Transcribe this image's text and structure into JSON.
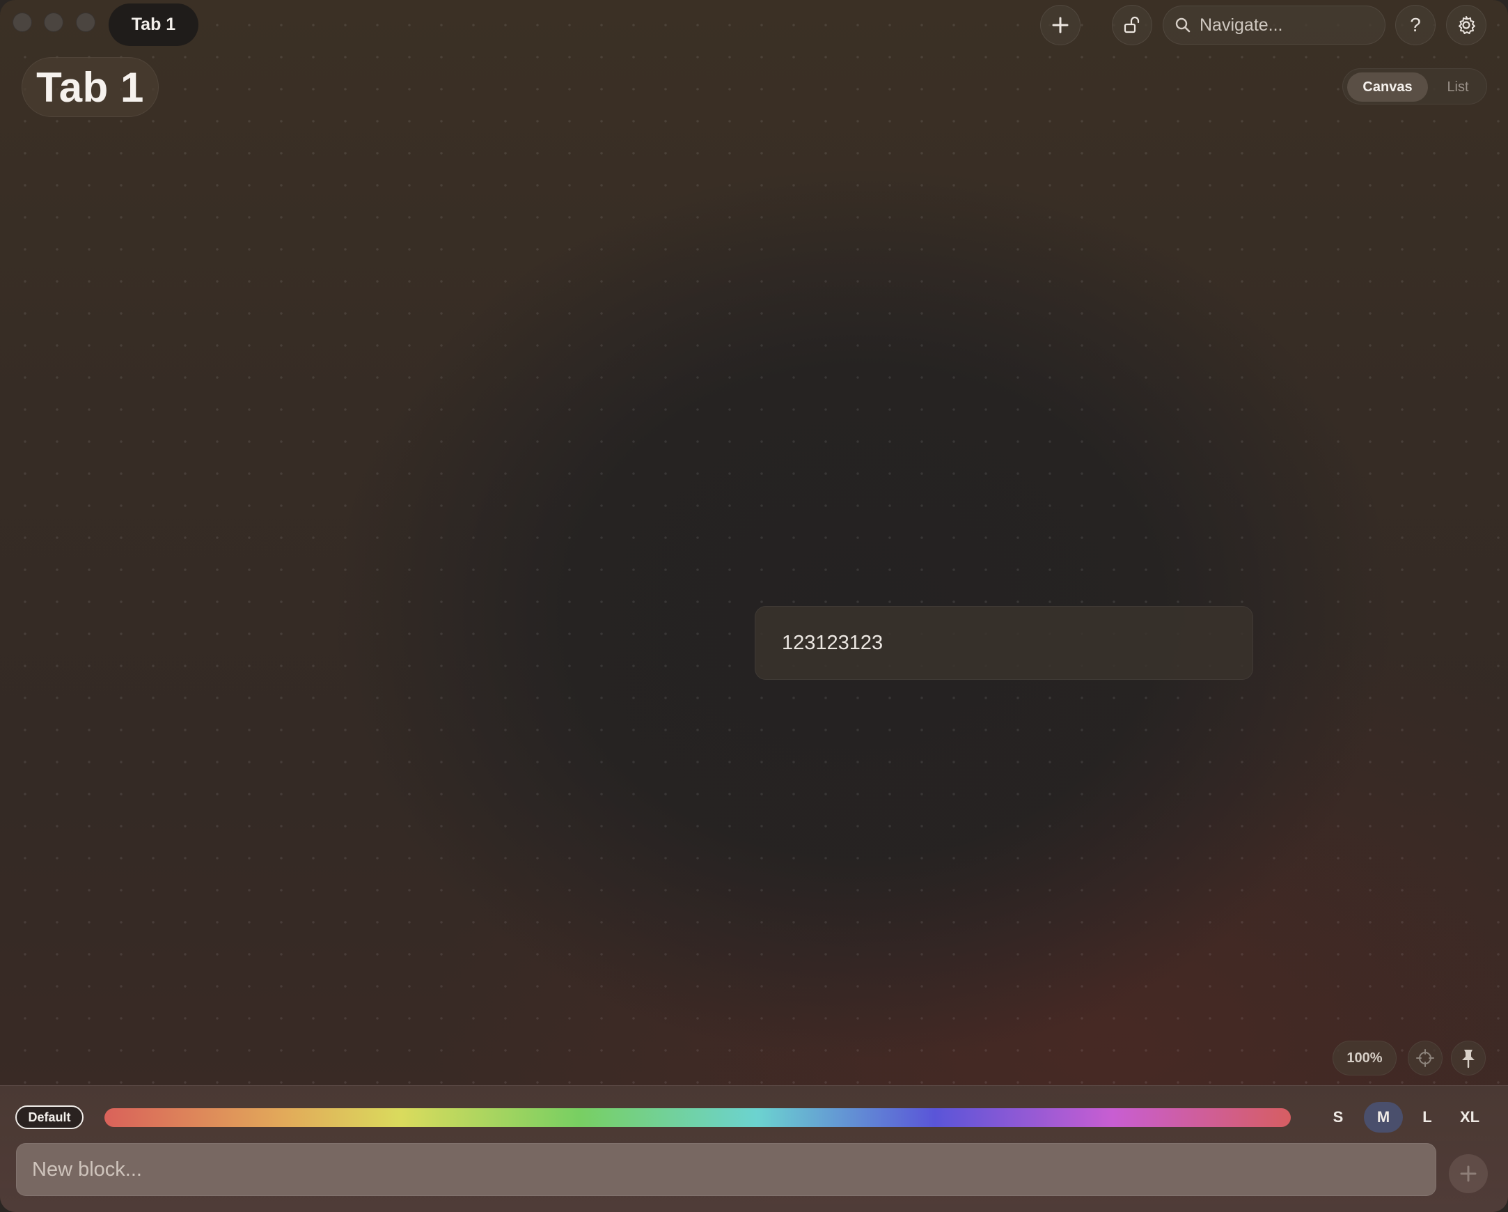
{
  "titlebar": {
    "tab_label": "Tab 1",
    "search_placeholder": "Navigate...",
    "add_icon": "plus-icon",
    "lock_icon": "unlock-icon",
    "help_label": "?",
    "settings_icon": "gear-icon"
  },
  "page": {
    "title": "Tab 1",
    "view_modes": [
      "Canvas",
      "List"
    ],
    "active_view": "Canvas"
  },
  "canvas": {
    "blocks": [
      {
        "text": "123123123"
      }
    ]
  },
  "canvas_controls": {
    "zoom_label": "100%",
    "center_icon": "crosshair-icon",
    "pin_icon": "pin-icon"
  },
  "composer": {
    "style_label": "Default",
    "sizes": [
      "S",
      "M",
      "L",
      "XL"
    ],
    "selected_size": "M",
    "input_placeholder": "New block...",
    "submit_icon": "plus-icon"
  },
  "colors": {
    "accent_selected": "#4a4f6c",
    "palette": [
      "#d9625a",
      "#e2a95a",
      "#dadb5d",
      "#78cf62",
      "#6cd3d0",
      "#5a55d8",
      "#c85ed2",
      "#d65e62"
    ]
  }
}
